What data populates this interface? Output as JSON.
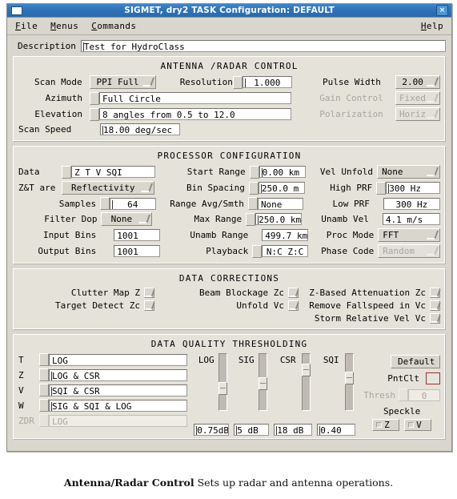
{
  "window": {
    "title": "SIGMET, dry2   TASK Configuration: DEFAULT",
    "close_label": "×"
  },
  "menubar": {
    "items": [
      {
        "mnemonic": "F",
        "rest": "ile"
      },
      {
        "mnemonic": "M",
        "rest": "enus"
      },
      {
        "mnemonic": "C",
        "rest": "ommands"
      }
    ],
    "help": {
      "mnemonic": "H",
      "rest": "elp"
    }
  },
  "description": {
    "label": "Description",
    "value": "Test for HydroClass"
  },
  "antenna": {
    "title": "ANTENNA /RADAR CONTROL",
    "scan_mode_label": "Scan Mode",
    "scan_mode_value": "PPI Full",
    "resolution_label": "Resolution",
    "resolution_value": "1.000",
    "pulse_width_label": "Pulse Width",
    "pulse_width_value": "2.00",
    "azimuth_label": "Azimuth",
    "azimuth_value": "Full Circle",
    "gain_control_label": "Gain Control",
    "gain_control_value": "Fixed",
    "elevation_label": "Elevation",
    "elevation_value": "8 angles from 0.5 to 12.0",
    "polarization_label": "Polarization",
    "polarization_value": "Horiz",
    "scan_speed_label": "Scan Speed",
    "scan_speed_value": "18.00 deg/sec"
  },
  "processor": {
    "title": "PROCESSOR CONFIGURATION",
    "data_label": "Data",
    "data_value": "Z T V SQI",
    "start_range_label": "Start Range",
    "start_range_value": "0.00 km",
    "vel_unfold_label": "Vel Unfold",
    "vel_unfold_value": "None",
    "zt_are_label": "Z&T are",
    "zt_are_value": "Reflectivity",
    "bin_spacing_label": "Bin Spacing",
    "bin_spacing_value": "250.0 m",
    "high_prf_label": "High PRF",
    "high_prf_value": "300 Hz",
    "samples_label": "Samples",
    "samples_value": "64",
    "range_avg_label": "Range Avg/Smth",
    "range_avg_value": "None",
    "low_prf_label": "Low PRF",
    "low_prf_value": "300 Hz",
    "filter_dop_label": "Filter Dop",
    "filter_dop_value": "None",
    "max_range_label": "Max Range",
    "max_range_value": "250.0 km",
    "unamb_vel_label": "Unamb Vel",
    "unamb_vel_value": "4.1 m/s",
    "input_bins_label": "Input Bins",
    "input_bins_value": "1001",
    "unamb_range_label": "Unamb Range",
    "unamb_range_value": "499.7 km",
    "proc_mode_label": "Proc Mode",
    "proc_mode_value": "FFT",
    "output_bins_label": "Output Bins",
    "output_bins_value": "1001",
    "playback_label": "Playback",
    "playback_value": "N:C Z:C",
    "phase_code_label": "Phase Code",
    "phase_code_value": "Random"
  },
  "corrections": {
    "title": "DATA CORRECTIONS",
    "clutter_map_z": "Clutter Map Z",
    "beam_blockage_zc": "Beam Blockage Zc",
    "z_based_atten_zc": "Z-Based Attenuation Zc",
    "target_detect_zc": "Target Detect Zc",
    "unfold_vc": "Unfold Vc",
    "remove_fallspeed_vc": "Remove Fallspeed in Vc",
    "storm_relative_vel_vc": "Storm Relative Vel Vc"
  },
  "thresholding": {
    "title": "DATA QUALITY THRESHOLDING",
    "rows": [
      {
        "name": "T",
        "value": "LOG",
        "dim": false
      },
      {
        "name": "Z",
        "value": "LOG & CSR",
        "dim": false
      },
      {
        "name": "V",
        "value": "SQI & CSR",
        "dim": false
      },
      {
        "name": "W",
        "value": "SIG & SQI & LOG",
        "dim": false
      },
      {
        "name": "ZDR",
        "value": "LOG",
        "dim": true
      }
    ],
    "sliders": [
      {
        "label": "LOG",
        "value": "0.75dB",
        "thumb_pct": 63
      },
      {
        "label": "SIG",
        "value": "5 dB",
        "thumb_pct": 52
      },
      {
        "label": "CSR",
        "value": "18 dB",
        "thumb_pct": 22
      },
      {
        "label": "SQI",
        "value": "0.40",
        "thumb_pct": 40
      }
    ],
    "default_label": "Default",
    "pntclt_label": "PntClt",
    "pntclt_color": "#9b2f2b",
    "thresh_label": "Thresh",
    "thresh_value": "0",
    "speckle_label": "Speckle",
    "speckle_z": "Z",
    "speckle_v": "V"
  },
  "caption": {
    "bold": "Antenna/Radar Control",
    "rest": " Sets up radar and antenna operations."
  }
}
